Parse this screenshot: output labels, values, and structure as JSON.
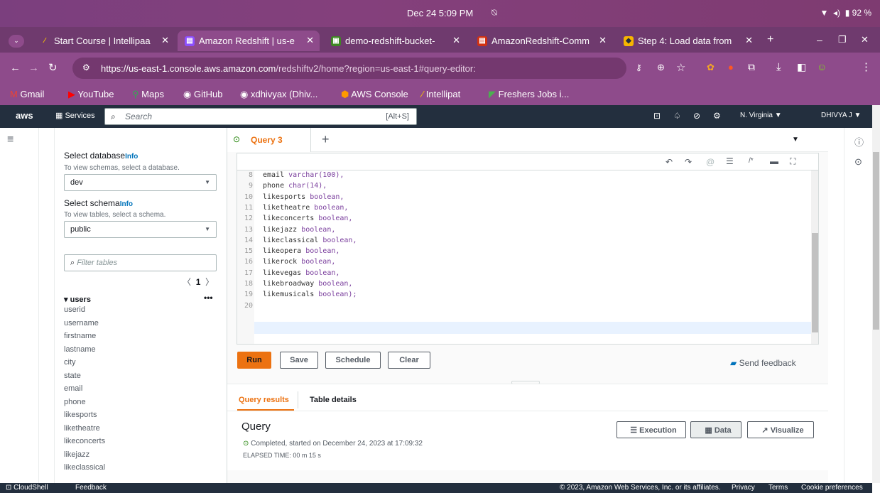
{
  "os": {
    "clock": "Dec 24   5:09 PM",
    "battery": "92 %"
  },
  "browser": {
    "tabs": [
      {
        "label": "Start Course | Intellipaa",
        "icon": "intellipaat-icon"
      },
      {
        "label": "Amazon Redshift | us-e",
        "icon": "redshift-icon"
      },
      {
        "label": "demo-redshift-bucket-",
        "icon": "s3-icon"
      },
      {
        "label": "AmazonRedshift-Comm",
        "icon": "redshift-red-icon"
      },
      {
        "label": "Step 4: Load data from",
        "icon": "aws-doc-icon"
      }
    ],
    "url_host": "https://us-east-1.console.aws.amazon.com",
    "url_rest": "/redshiftv2/home?region=us-east-1#query-editor:",
    "bookmarks": [
      "Gmail",
      "YouTube",
      "Maps",
      "GitHub",
      "xdhivyax (Dhiv...",
      "AWS Console",
      "Intellipat",
      "Freshers Jobs i..."
    ]
  },
  "aws": {
    "services": "Services",
    "search_placeholder": "Search",
    "search_shortcut": "[Alt+S]",
    "region": "N. Virginia ▼",
    "user": "DHIVYA J ▼"
  },
  "left": {
    "db_label": "Select database",
    "db_info": "Info",
    "db_hint": "To view schemas, select a database.",
    "db_value": "dev",
    "schema_label": "Select schema",
    "schema_info": "Info",
    "schema_hint": "To view tables, select a schema.",
    "schema_value": "public",
    "filter_placeholder": "Filter tables",
    "page": "1",
    "table": "users",
    "columns": [
      "userid",
      "username",
      "firstname",
      "lastname",
      "city",
      "state",
      "email",
      "phone",
      "likesports",
      "liketheatre",
      "likeconcerts",
      "likejazz",
      "likeclassical"
    ]
  },
  "editor": {
    "query_tab": "Query 3",
    "lines": [
      {
        "n": "8",
        "name": "email",
        "type": "varchar(100),"
      },
      {
        "n": "9",
        "name": "phone",
        "type": "char(14),"
      },
      {
        "n": "10",
        "name": "likesports",
        "type": "boolean,"
      },
      {
        "n": "11",
        "name": "liketheatre",
        "type": "boolean,"
      },
      {
        "n": "12",
        "name": "likeconcerts",
        "type": "boolean,"
      },
      {
        "n": "13",
        "name": "likejazz",
        "type": "boolean,"
      },
      {
        "n": "14",
        "name": "likeclassical",
        "type": "boolean,"
      },
      {
        "n": "15",
        "name": "likeopera",
        "type": "boolean,"
      },
      {
        "n": "16",
        "name": "likerock",
        "type": "boolean,"
      },
      {
        "n": "17",
        "name": "likevegas",
        "type": "boolean,"
      },
      {
        "n": "18",
        "name": "likebroadway",
        "type": "boolean,"
      },
      {
        "n": "19",
        "name": "likemusicals",
        "type": "boolean);"
      },
      {
        "n": "20",
        "name": "",
        "type": ""
      }
    ],
    "run": "Run",
    "save": "Save",
    "schedule": "Schedule",
    "clear": "Clear",
    "feedback": "Send feedback"
  },
  "results": {
    "tab_results": "Query results",
    "tab_details": "Table details",
    "title": "Query",
    "status": "Completed, started on December 24, 2023 at 17:09:32",
    "elapsed": "ELAPSED TIME: 00 m 15 s",
    "execution": "Execution",
    "data": "Data",
    "visualize": "Visualize"
  },
  "footer": {
    "cloudshell": "CloudShell",
    "feedback": "Feedback",
    "copyright": "© 2023, Amazon Web Services, Inc. or its affiliates.",
    "privacy": "Privacy",
    "terms": "Terms",
    "cookies": "Cookie preferences"
  }
}
